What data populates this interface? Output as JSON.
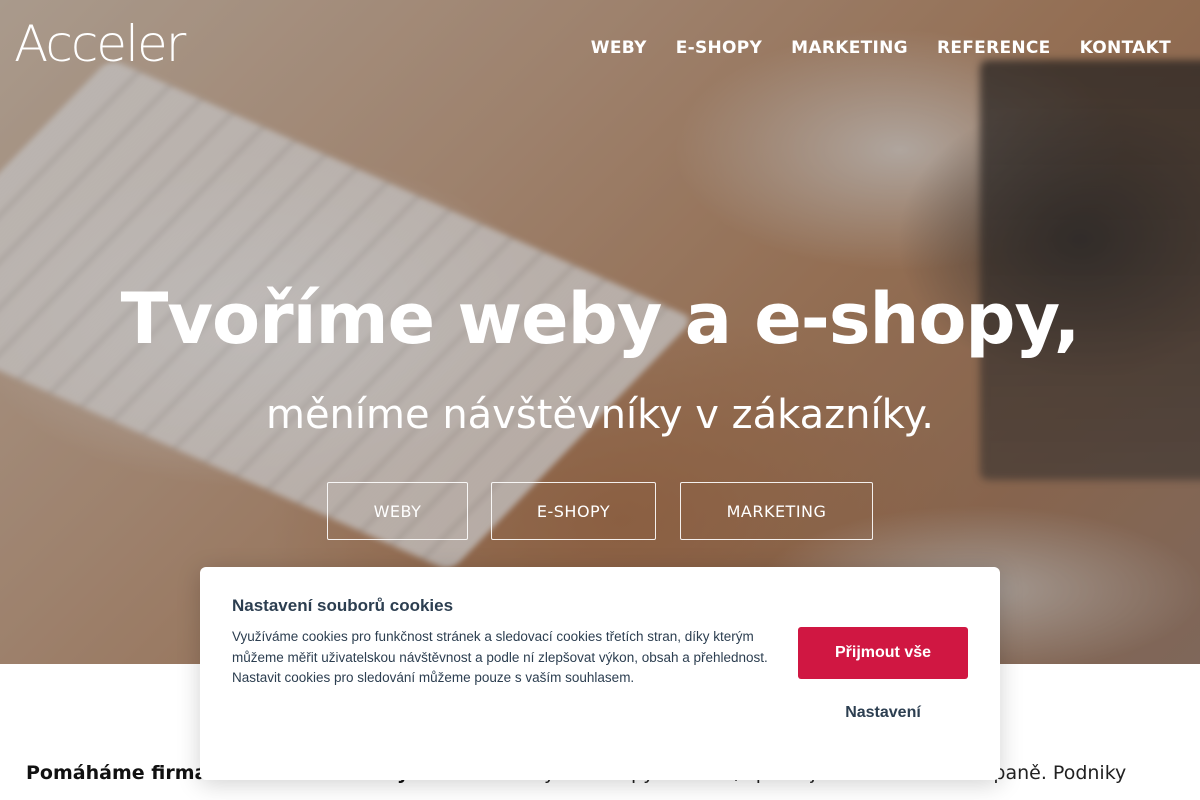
{
  "brand": {
    "logo_text": "Acceler"
  },
  "nav": {
    "items": [
      {
        "label": "WEBY"
      },
      {
        "label": "E-SHOPY"
      },
      {
        "label": "MARKETING"
      },
      {
        "label": "REFERENCE"
      },
      {
        "label": "KONTAKT"
      }
    ]
  },
  "hero": {
    "headline": "Tvoříme weby a e-shopy,",
    "subheadline": "měníme návštěvníky v zákazníky.",
    "buttons": [
      {
        "label": "WEBY"
      },
      {
        "label": "E-SHOPY"
      },
      {
        "label": "MARKETING"
      }
    ]
  },
  "intro": {
    "bold": "Pomáháme firmám získat zákazníky.",
    "text": " Stavíme weby a e-shopy na míru, spravujeme reklamní kampaně. Podniky"
  },
  "cookie_banner": {
    "title": "Nastavení souborů cookies",
    "text": "Využíváme cookies pro funkčnost stránek a sledovací cookies třetích stran, díky kterým můžeme měřit uživatelskou návštěvnost a podle ní zlepšovat výkon, obsah a přehlednost. Nastavit cookies pro sledování můžeme pouze s vaším souhlasem.",
    "accept_label": "Přijmout vše",
    "settings_label": "Nastavení",
    "accent_color": "#d01742"
  }
}
